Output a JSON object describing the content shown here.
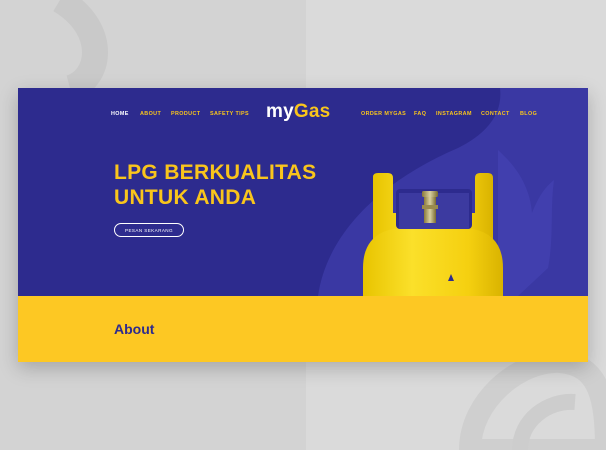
{
  "nav": {
    "left": [
      "HOME",
      "ABOUT",
      "PRODUCT",
      "SAFETY TIPS"
    ],
    "right": [
      "ORDER MYGAS",
      "FAQ",
      "INSTAGRAM",
      "CONTACT",
      "BLOG"
    ],
    "active": "HOME"
  },
  "logo": {
    "prefix": "my",
    "suffix": "Gas"
  },
  "hero": {
    "headline_line1": "LPG BERKUALITAS",
    "headline_line2": "UNTUK ANDA",
    "cta_label": "PESAN SEKARANG"
  },
  "about": {
    "title": "About"
  },
  "colors": {
    "primary_blue": "#2d2b8e",
    "accent_yellow": "#f9c51c",
    "section_yellow": "#fdc823",
    "backdrop_gray": "#d5d5d5"
  }
}
